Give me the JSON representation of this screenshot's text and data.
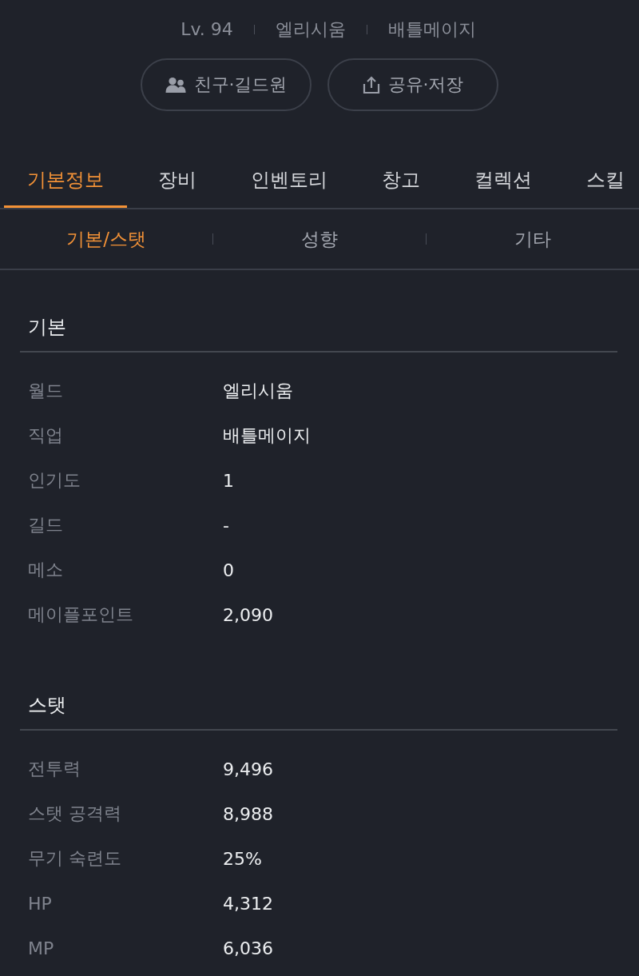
{
  "header": {
    "meta": [
      "Lv. 94",
      "엘리시움",
      "배틀메이지"
    ],
    "buttons": [
      {
        "kind": "friends",
        "label": "친구·길드원"
      },
      {
        "kind": "share",
        "label": "공유·저장"
      }
    ]
  },
  "tabs": [
    {
      "label": "기본정보",
      "selected": true
    },
    {
      "label": "장비",
      "selected": false
    },
    {
      "label": "인벤토리",
      "selected": false
    },
    {
      "label": "창고",
      "selected": false
    },
    {
      "label": "컬렉션",
      "selected": false
    },
    {
      "label": "스킬",
      "selected": false
    }
  ],
  "subtabs": [
    {
      "label": "기본/스탯",
      "selected": true
    },
    {
      "label": "성향",
      "selected": false
    },
    {
      "label": "기타",
      "selected": false
    }
  ],
  "sections": [
    {
      "title": "기본",
      "rows": [
        {
          "label": "월드",
          "value": "엘리시움"
        },
        {
          "label": "직업",
          "value": "배틀메이지"
        },
        {
          "label": "인기도",
          "value": "1"
        },
        {
          "label": "길드",
          "value": "-"
        },
        {
          "label": "메소",
          "value": "0"
        },
        {
          "label": "메이플포인트",
          "value": "2,090"
        }
      ]
    },
    {
      "title": "스탯",
      "rows": [
        {
          "label": "전투력",
          "value": "9,496"
        },
        {
          "label": "스탯 공격력",
          "value": "8,988"
        },
        {
          "label": "무기 숙련도",
          "value": "25%"
        },
        {
          "label": "HP",
          "value": "4,312"
        },
        {
          "label": "MP",
          "value": "6,036"
        }
      ]
    }
  ]
}
